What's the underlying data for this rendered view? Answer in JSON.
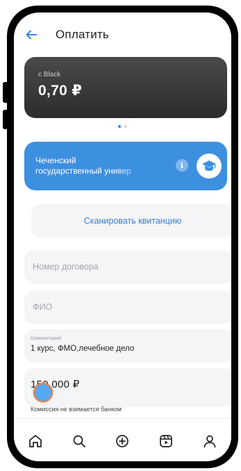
{
  "header": {
    "title": "Оплатить",
    "back_icon": "arrow-left-icon"
  },
  "card": {
    "name": "c Black",
    "balance": "0,70 ₽"
  },
  "pager": {
    "pages": 2,
    "active": 1
  },
  "recipient": {
    "name_line1": "Чеченский",
    "name_line2": "государственный универ",
    "info_icon_glyph": "i",
    "logo_icon": "graduation-cap-icon"
  },
  "scan": {
    "label": "Сканировать квитанцию"
  },
  "form": {
    "contract": {
      "placeholder": "Номер договора"
    },
    "fio": {
      "placeholder": "ФИО"
    },
    "comment": {
      "label": "Комментарий",
      "value": "1 курс, ФМО,лечебное дело"
    },
    "amount": {
      "value": "150 000 ₽"
    },
    "commission": "Комиссия не взимается банком"
  },
  "tabbar": {
    "items": [
      {
        "icon": "home-icon"
      },
      {
        "icon": "search-icon"
      },
      {
        "icon": "plus-circle-icon"
      },
      {
        "icon": "video-icon"
      },
      {
        "icon": "profile-icon"
      }
    ]
  },
  "colors": {
    "accent": "#3d8fe0",
    "card": "#3a3a3a",
    "field": "#f4f5f7",
    "link": "#3a7fd0"
  }
}
